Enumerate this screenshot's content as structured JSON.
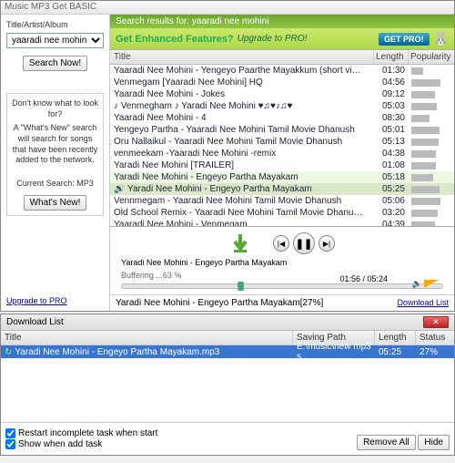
{
  "app": {
    "title": "Music MP3 Get BASIC"
  },
  "left": {
    "label": "Title/Artist/Album",
    "query": "yaaradi nee mohini",
    "search_btn": "Search Now!",
    "panel1_title": "Don't know what to look for?",
    "panel1_body": "A \"What's New\" search will search for songs that have been recently added to the network.",
    "current": "Current Search: MP3",
    "whatsnew": "What's New!",
    "upgrade": "Upgrade to PRO"
  },
  "results": {
    "header": "Search results for: yaaradi nee mohini",
    "promo_main": "Get Enhanced Features?",
    "promo_sub": "Upgrade to PRO!",
    "getpro": "GET PRO!",
    "cols": {
      "title": "Title",
      "length": "Length",
      "pop": "Popularity"
    },
    "rows": [
      {
        "t": "Yaaradi Nee Mohini - Yengeyo Paarthe Mayakkum (short vi…",
        "l": "01:30",
        "p": 30
      },
      {
        "t": "Venmegam [Yaaradi Nee Mohini] HQ",
        "l": "04:56",
        "p": 72
      },
      {
        "t": "Yaaradi Nee Mohini - Jokes",
        "l": "09:12",
        "p": 60
      },
      {
        "t": "♪ Venmegham ♪ Yaradi Nee Mohini ♥♫♥♪♫♥",
        "l": "05:03",
        "p": 63
      },
      {
        "t": "Yaaradi Nee Mohini - 4",
        "l": "08:30",
        "p": 45
      },
      {
        "t": "Yengeyo Partha - Yaaradi Nee Mohini Tamil Movie Dhanush",
        "l": "05:01",
        "p": 70
      },
      {
        "t": "Oru Nallaikul - Yaaradi Nee Mohini Tamil Movie Dhanush",
        "l": "05:13",
        "p": 68
      },
      {
        "t": "venmeekam -Yaaradi Nee Mohini -remix",
        "l": "04:38",
        "p": 62
      },
      {
        "t": "Yaradi Nee Mohini [TRAILER]",
        "l": "01:08",
        "p": 62
      },
      {
        "t": "Yaradi Nee Mohini - Engeyo Partha Mayakam",
        "l": "05:18",
        "p": 55,
        "hl": 1
      },
      {
        "t": "Yaradi Nee Mohini - Engeyo Partha Mayakam",
        "l": "05:25",
        "p": 70,
        "sel": 1
      },
      {
        "t": "Vennmegam - Yaaradi Nee Mohini Tamil Movie Dhanush",
        "l": "05:06",
        "p": 72
      },
      {
        "t": "Old School Remix - Yaaradi Nee Mohini Tamil Movie Dhanu…",
        "l": "03:20",
        "p": 65
      },
      {
        "t": "Yaaradi Nee Mohini - Venmegam",
        "l": "04:39",
        "p": 60
      }
    ]
  },
  "player": {
    "now_playing": "Yaradi Nee Mohini - Engeyo Partha Mayakam",
    "buffer": "Buffering ...63 %",
    "time": "01:56 / 05:24",
    "progress_pct": 36
  },
  "status": {
    "left": "Yaradi Nee Mohini - Engeyo Partha Mayakam[27%]",
    "right": "Download List"
  },
  "dl": {
    "title": "Download List",
    "cols": {
      "title": "Title",
      "path": "Saving Path",
      "length": "Length",
      "status": "Status"
    },
    "row": {
      "title": "Yaradi Nee Mohini - Engeyo Partha Mayakam.mp3",
      "path": "E:\\music\\new mp3 s…",
      "length": "05:25",
      "status": "27%"
    },
    "chk1": "Restart incomplete task when start",
    "chk2": "Show when add task",
    "remove": "Remove All",
    "hide": "Hide"
  }
}
